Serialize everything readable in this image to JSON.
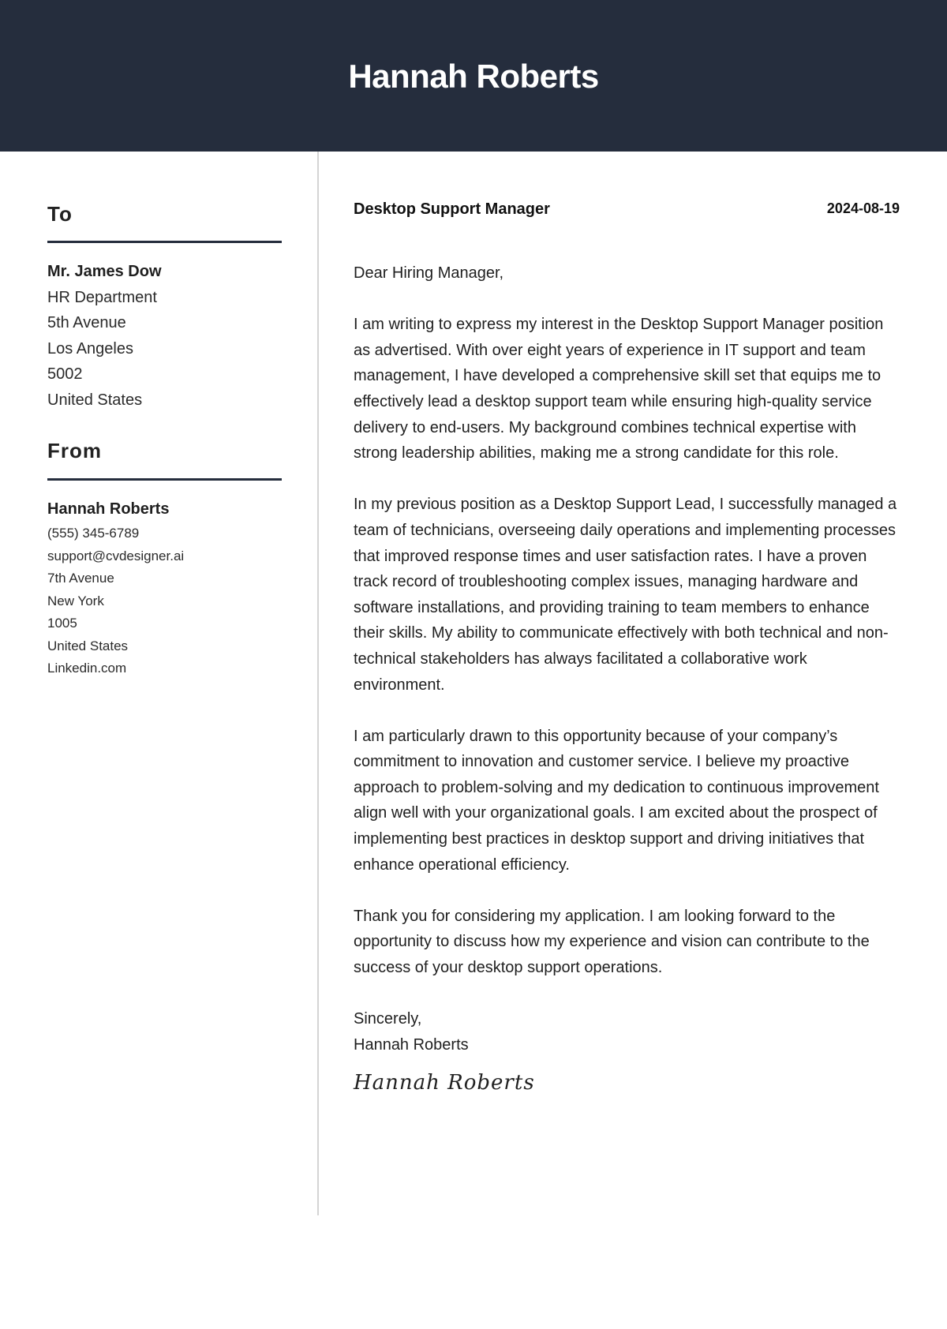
{
  "header": {
    "name": "Hannah Roberts"
  },
  "sidebar": {
    "to": {
      "title": "To",
      "recipient_name": "Mr. James Dow",
      "lines": [
        "HR Department",
        "5th Avenue",
        "Los Angeles",
        "5002",
        "United States"
      ]
    },
    "from": {
      "title": "From",
      "sender_name": "Hannah Roberts",
      "lines": [
        "(555) 345-6789",
        "support@cvdesigner.ai",
        "7th Avenue",
        "New York",
        "1005",
        "United States",
        "Linkedin.com"
      ]
    }
  },
  "main": {
    "job_title": "Desktop Support Manager",
    "date": "2024-08-19",
    "salutation": "Dear Hiring Manager,",
    "paragraphs": [
      "I am writing to express my interest in the Desktop Support Manager position as advertised. With over eight years of experience in IT support and team management, I have developed a comprehensive skill set that equips me to effectively lead a desktop support team while ensuring high-quality service delivery to end-users. My background combines technical expertise with strong leadership abilities, making me a strong candidate for this role.",
      "In my previous position as a Desktop Support Lead, I successfully managed a team of technicians, overseeing daily operations and implementing processes that improved response times and user satisfaction rates. I have a proven track record of troubleshooting complex issues, managing hardware and software installations, and providing training to team members to enhance their skills. My ability to communicate effectively with both technical and non-technical stakeholders has always facilitated a collaborative work environment.",
      "I am particularly drawn to this opportunity because of your company’s commitment to innovation and customer service. I believe my proactive approach to problem-solving and my dedication to continuous improvement align well with your organizational goals. I am excited about the prospect of implementing best practices in desktop support and driving initiatives that enhance operational efficiency.",
      "Thank you for considering my application. I am looking forward to the opportunity to discuss how my experience and vision can contribute to the success of your desktop support operations."
    ],
    "closing": "Sincerely,",
    "closing_name": "Hannah Roberts",
    "signature": "Hannah Roberts"
  },
  "colors": {
    "header_bg": "#252d3d",
    "rule": "#252d3d",
    "divider": "#d4d4d4"
  }
}
